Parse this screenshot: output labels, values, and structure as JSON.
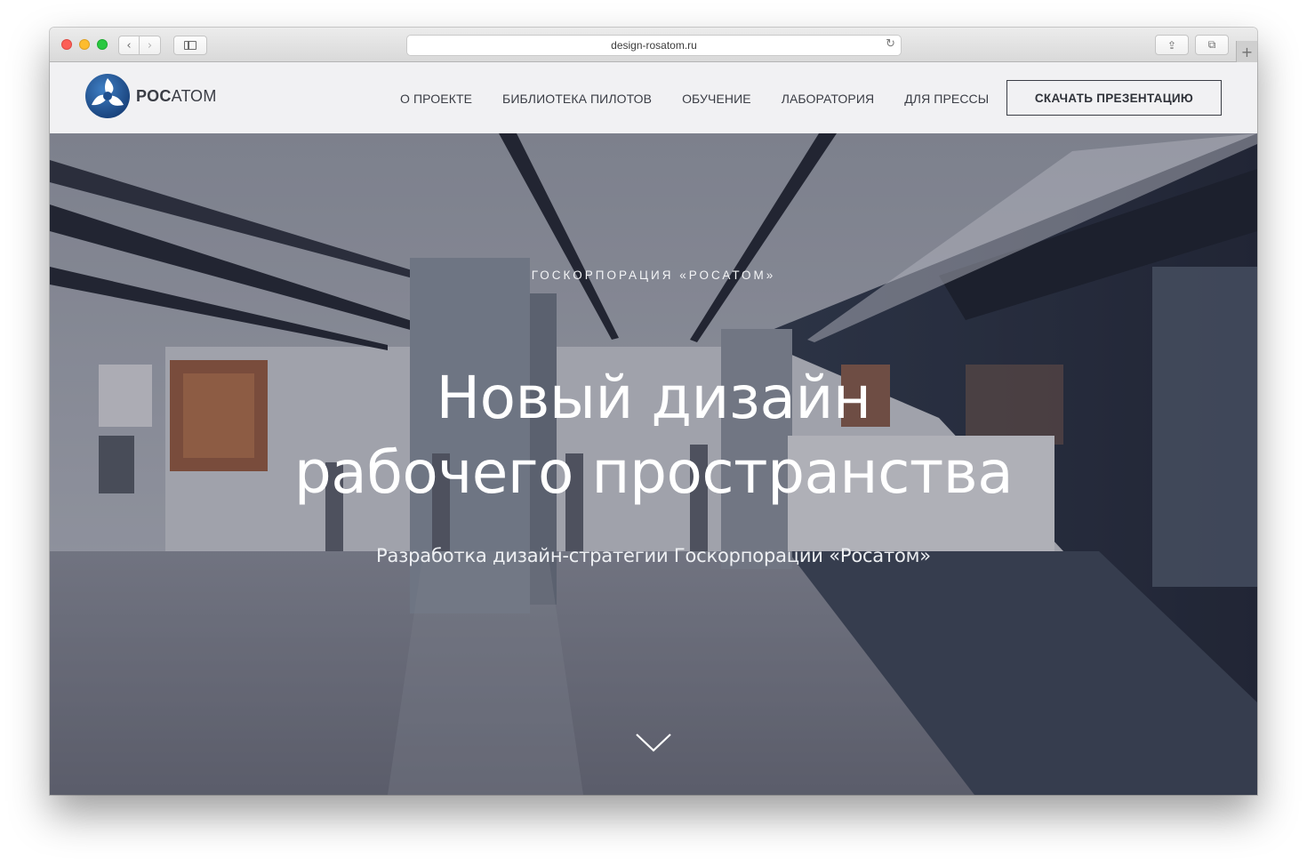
{
  "browser": {
    "url": "design-rosatom.ru",
    "back_icon": "‹",
    "forward_icon": "›",
    "reload_icon": "↻",
    "share_icon": "⇪",
    "tabs_icon": "⧉",
    "newtab_icon": "+"
  },
  "site": {
    "logo_text_bold": "РОС",
    "logo_text_regular": "АТОМ",
    "nav": [
      "О ПРОЕКТЕ",
      "БИБЛИОТЕКА ПИЛОТОВ",
      "ОБУЧЕНИЕ",
      "ЛАБОРАТОРИЯ",
      "ДЛЯ ПРЕССЫ"
    ],
    "cta_label": "СКАЧАТЬ ПРЕЗЕНТАЦИЮ",
    "brand_color": "#1f4c8a"
  },
  "hero": {
    "eyebrow": "ГОСКОРПОРАЦИЯ «РОСАТОМ»",
    "title_line1": "Новый дизайн",
    "title_line2": "рабочего пространства",
    "subtitle": "Разработка дизайн-стратегии Госкорпорации «Росатом»",
    "scroll_icon": "chevron-down-icon"
  }
}
